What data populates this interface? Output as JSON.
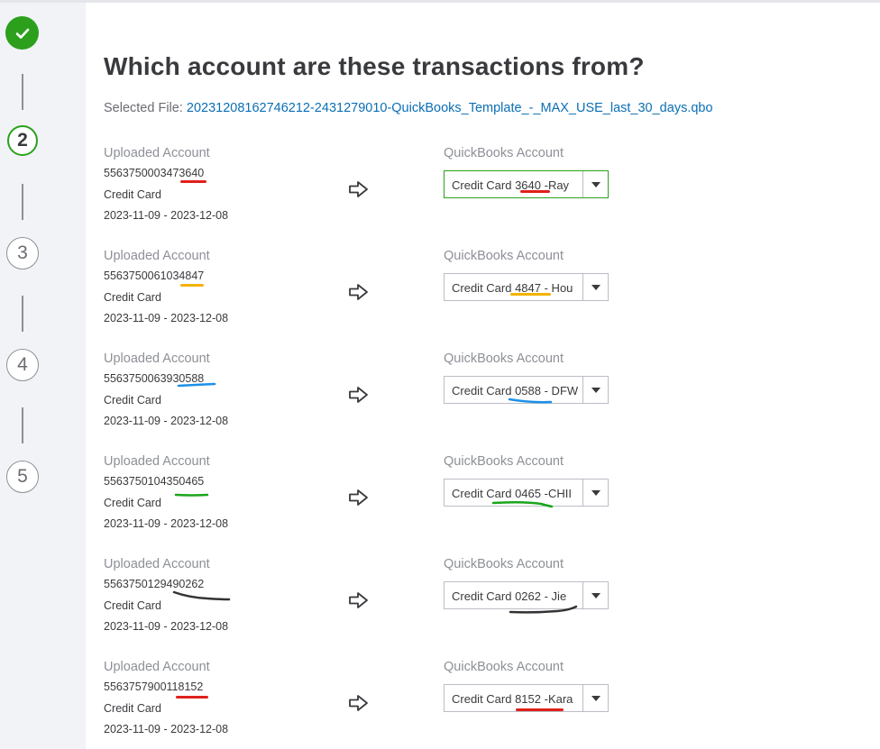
{
  "stepper": {
    "steps": [
      "",
      "2",
      "3",
      "4",
      "5"
    ]
  },
  "page": {
    "title": "Which account are these transactions from?",
    "selected_file_label": "Selected File:",
    "selected_file_name": "20231208162746212-2431279010-QuickBooks_Template_-_MAX_USE_last_30_days.qbo"
  },
  "rows": [
    {
      "uploaded_label": "Uploaded Account",
      "account_number": "5563750003473640",
      "account_type": "Credit Card",
      "date_range": "2023-11-09 - 2023-12-08",
      "qb_label": "QuickBooks Account",
      "qb_value": "Credit Card 3640 -Ray"
    },
    {
      "uploaded_label": "Uploaded Account",
      "account_number": "5563750061034847",
      "account_type": "Credit Card",
      "date_range": "2023-11-09 - 2023-12-08",
      "qb_label": "QuickBooks Account",
      "qb_value": "Credit Card 4847 - Hou"
    },
    {
      "uploaded_label": "Uploaded Account",
      "account_number": "5563750063930588",
      "account_type": "Credit Card",
      "date_range": "2023-11-09 - 2023-12-08",
      "qb_label": "QuickBooks Account",
      "qb_value": "Credit Card 0588 - DFW"
    },
    {
      "uploaded_label": "Uploaded Account",
      "account_number": "5563750104350465",
      "account_type": "Credit Card",
      "date_range": "2023-11-09 - 2023-12-08",
      "qb_label": "QuickBooks Account",
      "qb_value": "Credit Card 0465 -CHII"
    },
    {
      "uploaded_label": "Uploaded Account",
      "account_number": "5563750129490262",
      "account_type": "Credit Card",
      "date_range": "2023-11-09 - 2023-12-08",
      "qb_label": "QuickBooks Account",
      "qb_value": "Credit Card 0262 - Jie"
    },
    {
      "uploaded_label": "Uploaded Account",
      "account_number": "5563757900118152",
      "account_type": "Credit Card",
      "date_range": "2023-11-09 - 2023-12-08",
      "qb_label": "QuickBooks Account",
      "qb_value": "Credit Card 8152 -Kara"
    }
  ],
  "colors": {
    "accent_green": "#2ca01c",
    "link_blue": "#0b6fb4",
    "annotation_red": "#e0201b",
    "annotation_yellow": "#f3b300",
    "annotation_blue": "#1e90e8",
    "annotation_green": "#1aa51a",
    "annotation_black": "#333333"
  },
  "icons": {
    "step_done": "checkmark-icon",
    "row_arrow": "right-arrow-icon",
    "dropdown": "caret-down-icon"
  }
}
